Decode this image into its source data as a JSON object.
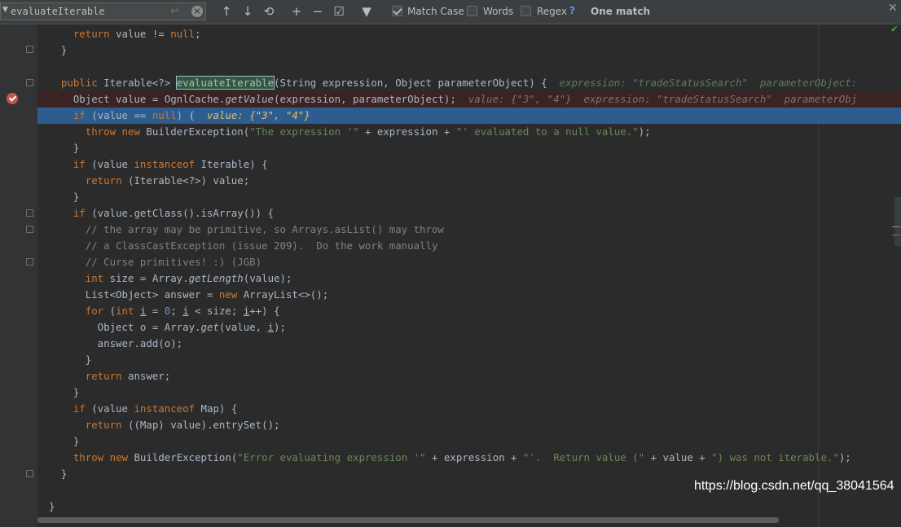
{
  "find_bar": {
    "query": "evaluateIterable",
    "match_case_label": "Match Case",
    "match_case_checked": true,
    "words_label": "Words",
    "words_checked": false,
    "regex_label": "Regex",
    "regex_checked": false,
    "help": "?",
    "match_count": "One match",
    "icons": [
      "up-arrow-icon",
      "down-arrow-icon",
      "find-all-icon",
      "add-selection-icon",
      "remove-selection-icon",
      "select-all-icon",
      "filter-icon",
      "close-icon"
    ]
  },
  "editor": {
    "lines": [
      {
        "segments": [
          {
            "t": "    "
          },
          {
            "t": "return",
            "c": "kw"
          },
          {
            "t": " value != "
          },
          {
            "t": "null",
            "c": "kw"
          },
          {
            "t": ";"
          }
        ]
      },
      {
        "segments": [
          {
            "t": "  }"
          }
        ]
      },
      {
        "segments": [
          {
            "t": ""
          }
        ]
      },
      {
        "segments": [
          {
            "t": "  "
          },
          {
            "t": "public",
            "c": "kw"
          },
          {
            "t": " Iterable<?> "
          },
          {
            "t": "evaluateIterable",
            "c": "hl"
          },
          {
            "t": "(String expression, Object parameterObject) {  "
          },
          {
            "t": "expression: \"tradeStatusSearch\"  parameterObject:",
            "c": "hint3"
          }
        ]
      },
      {
        "segments": [
          {
            "t": "    Object value = OgnlCache."
          },
          {
            "t": "getValue",
            "c": "it"
          },
          {
            "t": "(expression, parameterObject);  "
          },
          {
            "t": "value: {\"3\", \"4\"}  expression: \"tradeStatusSearch\"  parameterObj",
            "c": "hint2"
          }
        ],
        "kind": "bp"
      },
      {
        "segments": [
          {
            "t": "    "
          },
          {
            "t": "if",
            "c": "kw"
          },
          {
            "t": " (value == "
          },
          {
            "t": "null",
            "c": "kw"
          },
          {
            "t": ") {  "
          },
          {
            "t": "value: {\"3\", \"4\"}",
            "c": "hint"
          }
        ],
        "kind": "exec"
      },
      {
        "segments": [
          {
            "t": "      "
          },
          {
            "t": "throw",
            "c": "kw"
          },
          {
            "t": " "
          },
          {
            "t": "new",
            "c": "kw"
          },
          {
            "t": " BuilderException("
          },
          {
            "t": "\"The expression '\"",
            "c": "str"
          },
          {
            "t": " + expression + "
          },
          {
            "t": "\"' evaluated to a null value.\"",
            "c": "str"
          },
          {
            "t": ");"
          }
        ]
      },
      {
        "segments": [
          {
            "t": "    }"
          }
        ]
      },
      {
        "segments": [
          {
            "t": "    "
          },
          {
            "t": "if",
            "c": "kw"
          },
          {
            "t": " (value "
          },
          {
            "t": "instanceof",
            "c": "kw"
          },
          {
            "t": " Iterable) {"
          }
        ]
      },
      {
        "segments": [
          {
            "t": "      "
          },
          {
            "t": "return",
            "c": "kw"
          },
          {
            "t": " (Iterable<?>) value;"
          }
        ]
      },
      {
        "segments": [
          {
            "t": "    }"
          }
        ]
      },
      {
        "segments": [
          {
            "t": "    "
          },
          {
            "t": "if",
            "c": "kw"
          },
          {
            "t": " (value.getClass().isArray()) {"
          }
        ]
      },
      {
        "segments": [
          {
            "t": "      "
          },
          {
            "t": "// the array may be primitive, so Arrays.asList() may throw",
            "c": "cmt"
          }
        ]
      },
      {
        "segments": [
          {
            "t": "      "
          },
          {
            "t": "// a ClassCastException (issue 209).  Do the work manually",
            "c": "cmt"
          }
        ]
      },
      {
        "segments": [
          {
            "t": "      "
          },
          {
            "t": "// Curse primitives! :) (JGB)",
            "c": "cmt"
          }
        ]
      },
      {
        "segments": [
          {
            "t": "      "
          },
          {
            "t": "int",
            "c": "kw"
          },
          {
            "t": " size = Array."
          },
          {
            "t": "getLength",
            "c": "it"
          },
          {
            "t": "(value);"
          }
        ]
      },
      {
        "segments": [
          {
            "t": "      List<Object> answer = "
          },
          {
            "t": "new",
            "c": "kw"
          },
          {
            "t": " ArrayList<>();"
          }
        ]
      },
      {
        "segments": [
          {
            "t": "      "
          },
          {
            "t": "for",
            "c": "kw"
          },
          {
            "t": " ("
          },
          {
            "t": "int",
            "c": "kw"
          },
          {
            "t": " "
          },
          {
            "t": "i",
            "c": "ul"
          },
          {
            "t": " = "
          },
          {
            "t": "0",
            "c": "num"
          },
          {
            "t": "; "
          },
          {
            "t": "i",
            "c": "ul"
          },
          {
            "t": " < size; "
          },
          {
            "t": "i",
            "c": "ul"
          },
          {
            "t": "++) {"
          }
        ]
      },
      {
        "segments": [
          {
            "t": "        Object o = Array."
          },
          {
            "t": "get",
            "c": "it"
          },
          {
            "t": "(value, "
          },
          {
            "t": "i",
            "c": "ul"
          },
          {
            "t": ");"
          }
        ]
      },
      {
        "segments": [
          {
            "t": "        answer.add(o);"
          }
        ]
      },
      {
        "segments": [
          {
            "t": "      }"
          }
        ]
      },
      {
        "segments": [
          {
            "t": "      "
          },
          {
            "t": "return",
            "c": "kw"
          },
          {
            "t": " answer;"
          }
        ]
      },
      {
        "segments": [
          {
            "t": "    }"
          }
        ]
      },
      {
        "segments": [
          {
            "t": "    "
          },
          {
            "t": "if",
            "c": "kw"
          },
          {
            "t": " (value "
          },
          {
            "t": "instanceof",
            "c": "kw"
          },
          {
            "t": " Map) {"
          }
        ]
      },
      {
        "segments": [
          {
            "t": "      "
          },
          {
            "t": "return",
            "c": "kw"
          },
          {
            "t": " ((Map) value).entrySet();"
          }
        ]
      },
      {
        "segments": [
          {
            "t": "    }"
          }
        ]
      },
      {
        "segments": [
          {
            "t": "    "
          },
          {
            "t": "throw",
            "c": "kw"
          },
          {
            "t": " "
          },
          {
            "t": "new",
            "c": "kw"
          },
          {
            "t": " BuilderException("
          },
          {
            "t": "\"Error evaluating expression '\"",
            "c": "str"
          },
          {
            "t": " + expression + "
          },
          {
            "t": "\"'.  Return value (\"",
            "c": "str"
          },
          {
            "t": " + value + "
          },
          {
            "t": "\") was not iterable.\"",
            "c": "str"
          },
          {
            "t": ");"
          }
        ]
      },
      {
        "segments": [
          {
            "t": "  }"
          }
        ]
      },
      {
        "segments": [
          {
            "t": ""
          }
        ]
      },
      {
        "segments": [
          {
            "t": "}"
          }
        ]
      }
    ]
  },
  "watermark": "https://blog.csdn.net/qq_38041564"
}
